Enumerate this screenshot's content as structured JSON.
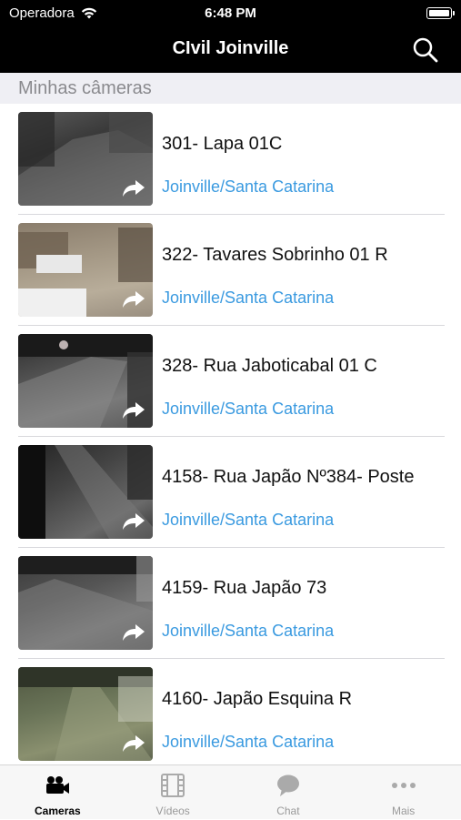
{
  "status_bar": {
    "carrier": "Operadora",
    "time": "6:48 PM",
    "wifi_icon": "wifi-icon",
    "battery_icon": "battery-icon"
  },
  "nav": {
    "title": "CIvil Joinville",
    "search_icon": "search-icon"
  },
  "section": {
    "title": "Minhas câmeras"
  },
  "cameras": [
    {
      "name": "301- Lapa 01C",
      "location": "Joinville/Santa Catarina"
    },
    {
      "name": "322- Tavares Sobrinho 01 R",
      "location": "Joinville/Santa Catarina"
    },
    {
      "name": "328- Rua Jaboticabal 01 C",
      "location": "Joinville/Santa Catarina"
    },
    {
      "name": "4158- Rua Japão Nº384- Poste",
      "location": "Joinville/Santa Catarina"
    },
    {
      "name": "4159- Rua Japão 73",
      "location": "Joinville/Santa Catarina"
    },
    {
      "name": "4160- Japão Esquina R",
      "location": "Joinville/Santa Catarina"
    }
  ],
  "tabs": [
    {
      "label": "Cameras",
      "icon": "video-camera-icon",
      "active": true
    },
    {
      "label": "Vídeos",
      "icon": "film-icon",
      "active": false
    },
    {
      "label": "Chat",
      "icon": "chat-bubble-icon",
      "active": false
    },
    {
      "label": "Mais",
      "icon": "more-dots-icon",
      "active": false
    }
  ],
  "colors": {
    "nav_background": "#000000",
    "accent": "#3a9ae0",
    "section_background": "#efeff4"
  }
}
